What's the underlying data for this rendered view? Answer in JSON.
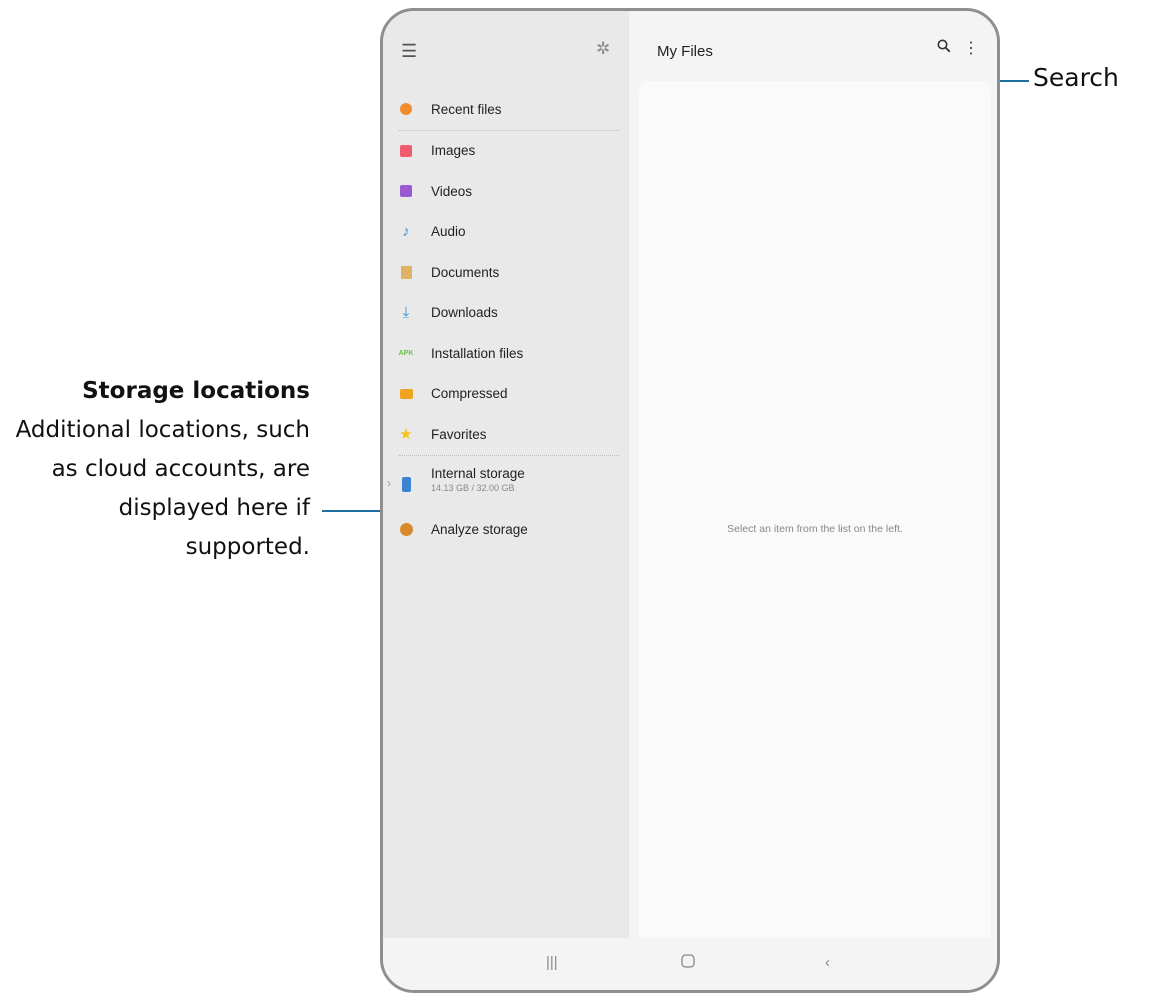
{
  "callouts": {
    "storage_title": "Storage locations",
    "storage_body": "Additional locations, such as cloud accounts, are displayed here if supported.",
    "search_label": "Search"
  },
  "drawer": {
    "menu_icon": "hamburger-icon",
    "settings_icon": "gear-icon",
    "items": [
      {
        "label": "Recent files",
        "icon": "clock-icon"
      },
      {
        "label": "Images",
        "icon": "image-icon"
      },
      {
        "label": "Videos",
        "icon": "video-icon"
      },
      {
        "label": "Audio",
        "icon": "music-note-icon"
      },
      {
        "label": "Documents",
        "icon": "document-icon"
      },
      {
        "label": "Downloads",
        "icon": "download-icon"
      },
      {
        "label": "Installation files",
        "icon": "apk-icon",
        "icon_text": "APK"
      },
      {
        "label": "Compressed",
        "icon": "folder-icon"
      },
      {
        "label": "Favorites",
        "icon": "star-icon"
      }
    ],
    "storage": [
      {
        "label": "Internal storage",
        "detail": "14.13 GB / 32.00 GB",
        "icon": "phone-storage-icon"
      },
      {
        "label": "Analyze storage",
        "icon": "analyze-icon"
      }
    ]
  },
  "pane": {
    "title": "My Files",
    "empty_message": "Select an item from the list on the left."
  },
  "colors": {
    "callout_line": "#1e6fa0",
    "drawer_bg": "#e9e9e9",
    "pane_bg": "#fafafa"
  }
}
